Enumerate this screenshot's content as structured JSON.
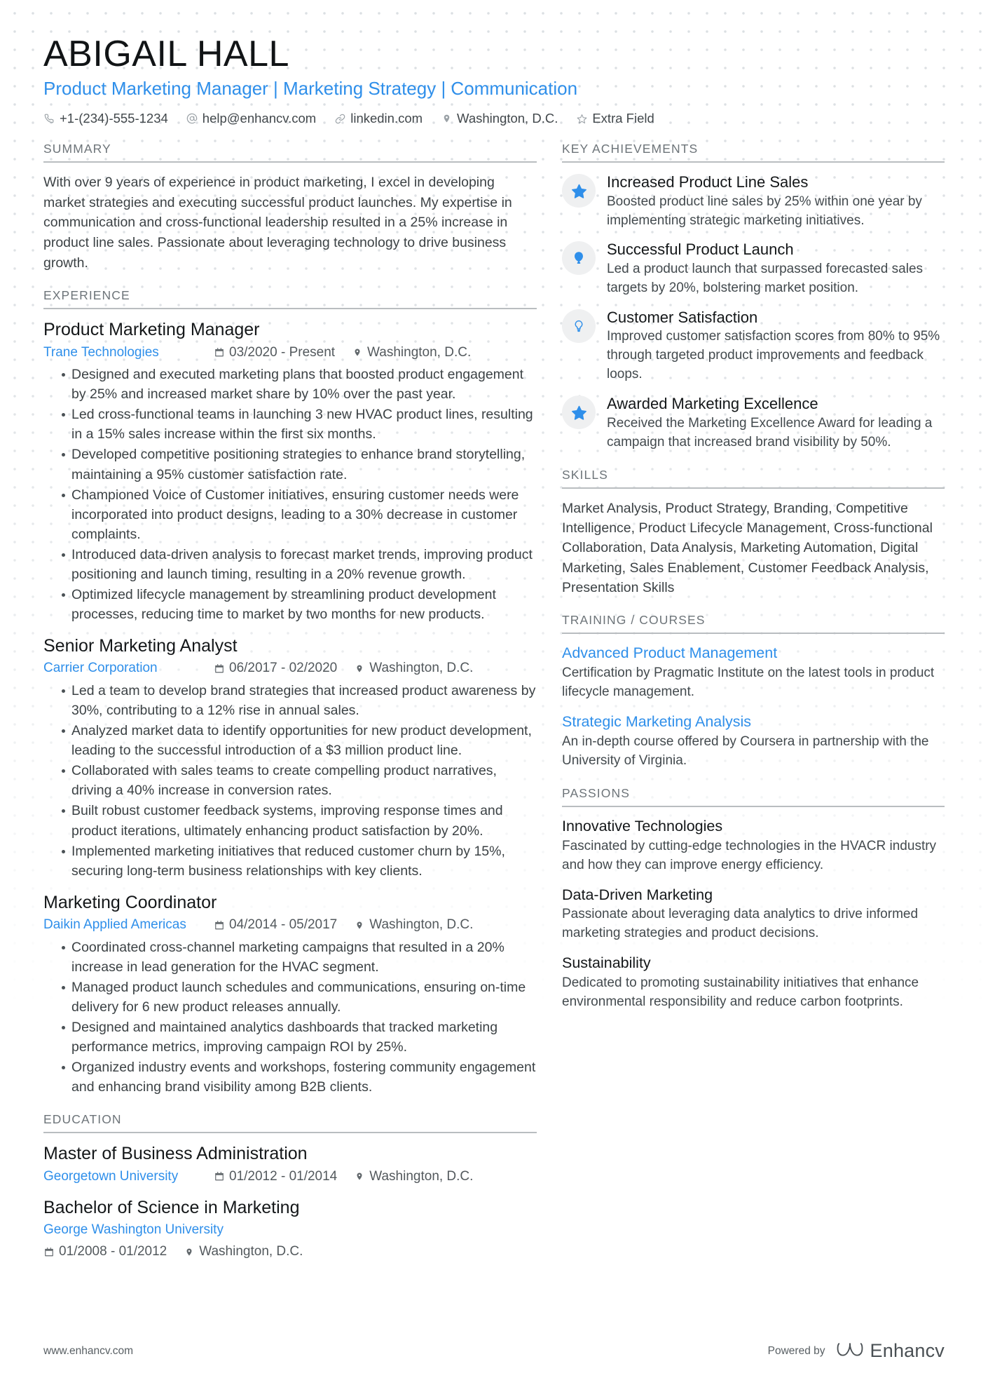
{
  "header": {
    "name": "ABIGAIL HALL",
    "headline": "Product Marketing Manager | Marketing Strategy | Communication",
    "accent_color": "#2f8fea",
    "contacts": [
      {
        "icon": "phone-icon",
        "text": "+1-(234)-555-1234"
      },
      {
        "icon": "at-sign-icon",
        "text": "help@enhancv.com"
      },
      {
        "icon": "link-icon",
        "text": "linkedin.com"
      },
      {
        "icon": "location-pin-icon",
        "text": "Washington, D.C."
      },
      {
        "icon": "star-outline-icon",
        "text": "Extra Field"
      }
    ]
  },
  "left": {
    "summary": {
      "title": "SUMMARY",
      "text": "With over 9 years of experience in product marketing, I excel in developing market strategies and executing successful product launches. My expertise in communication and cross-functional leadership resulted in a 25% increase in product line sales. Passionate about leveraging technology to drive business growth."
    },
    "experience": {
      "title": "EXPERIENCE",
      "entries": [
        {
          "role": "Product Marketing Manager",
          "org": "Trane Technologies",
          "dates": "03/2020 - Present",
          "location": "Washington, D.C.",
          "bullets": [
            "Designed and executed marketing plans that boosted product engagement by 25% and increased market share by 10% over the past year.",
            "Led cross-functional teams in launching 3 new HVAC product lines, resulting in a 15% sales increase within the first six months.",
            "Developed competitive positioning strategies to enhance brand storytelling, maintaining a 95% customer satisfaction rate.",
            "Championed Voice of Customer initiatives, ensuring customer needs were incorporated into product designs, leading to a 30% decrease in customer complaints.",
            "Introduced data-driven analysis to forecast market trends, improving product positioning and launch timing, resulting in a 20% revenue growth.",
            "Optimized lifecycle management by streamlining product development processes, reducing time to market by two months for new products."
          ]
        },
        {
          "role": "Senior Marketing Analyst",
          "org": "Carrier Corporation",
          "dates": "06/2017 - 02/2020",
          "location": "Washington, D.C.",
          "bullets": [
            "Led a team to develop brand strategies that increased product awareness by 30%, contributing to a 12% rise in annual sales.",
            "Analyzed market data to identify opportunities for new product development, leading to the successful introduction of a $3 million product line.",
            "Collaborated with sales teams to create compelling product narratives, driving a 40% increase in conversion rates.",
            "Built robust customer feedback systems, improving response times and product iterations, ultimately enhancing product satisfaction by 20%.",
            "Implemented marketing initiatives that reduced customer churn by 15%, securing long-term business relationships with key clients."
          ]
        },
        {
          "role": "Marketing Coordinator",
          "org": "Daikin Applied Americas",
          "dates": "04/2014 - 05/2017",
          "location": "Washington, D.C.",
          "bullets": [
            "Coordinated cross-channel marketing campaigns that resulted in a 20% increase in lead generation for the HVAC segment.",
            "Managed product launch schedules and communications, ensuring on-time delivery for 6 new product releases annually.",
            "Designed and maintained analytics dashboards that tracked marketing performance metrics, improving campaign ROI by 25%.",
            "Organized industry events and workshops, fostering community engagement and enhancing brand visibility among B2B clients."
          ]
        }
      ]
    },
    "education": {
      "title": "EDUCATION",
      "entries": [
        {
          "degree": "Master of Business Administration",
          "school": "Georgetown University",
          "dates": "01/2012 - 01/2014",
          "location": "Washington, D.C.",
          "stacked": false
        },
        {
          "degree": "Bachelor of Science in Marketing",
          "school": "George Washington University",
          "dates": "01/2008 - 01/2012",
          "location": "Washington, D.C.",
          "stacked": true
        }
      ]
    }
  },
  "right": {
    "achievements": {
      "title": "KEY ACHIEVEMENTS",
      "items": [
        {
          "icon": "star-icon",
          "title": "Increased Product Line Sales",
          "desc": "Boosted product line sales by 25% within one year by implementing strategic marketing initiatives."
        },
        {
          "icon": "balloon-icon",
          "title": "Successful Product Launch",
          "desc": "Led a product launch that surpassed forecasted sales targets by 20%, bolstering market position."
        },
        {
          "icon": "lightbulb-icon",
          "title": "Customer Satisfaction",
          "desc": "Improved customer satisfaction scores from 80% to 95% through targeted product improvements and feedback loops."
        },
        {
          "icon": "star-icon",
          "title": "Awarded Marketing Excellence",
          "desc": "Received the Marketing Excellence Award for leading a campaign that increased brand visibility by 50%."
        }
      ]
    },
    "skills": {
      "title": "SKILLS",
      "text": "Market Analysis, Product Strategy, Branding, Competitive Intelligence, Product Lifecycle Management, Cross-functional Collaboration, Data Analysis, Marketing Automation, Digital Marketing, Sales Enablement, Customer Feedback Analysis, Presentation Skills"
    },
    "training": {
      "title": "TRAINING / COURSES",
      "items": [
        {
          "name": "Advanced Product Management",
          "desc": "Certification by Pragmatic Institute on the latest tools in product lifecycle management."
        },
        {
          "name": "Strategic Marketing Analysis",
          "desc": "An in-depth course offered by Coursera in partnership with the University of Virginia."
        }
      ]
    },
    "passions": {
      "title": "PASSIONS",
      "items": [
        {
          "name": "Innovative Technologies",
          "desc": "Fascinated by cutting-edge technologies in the HVACR industry and how they can improve energy efficiency."
        },
        {
          "name": "Data-Driven Marketing",
          "desc": "Passionate about leveraging data analytics to drive informed marketing strategies and product decisions."
        },
        {
          "name": "Sustainability",
          "desc": "Dedicated to promoting sustainability initiatives that enhance environmental responsibility and reduce carbon footprints."
        }
      ]
    }
  },
  "footer": {
    "url": "www.enhancv.com",
    "powered_by": "Powered by",
    "brand": "Enhancv"
  }
}
